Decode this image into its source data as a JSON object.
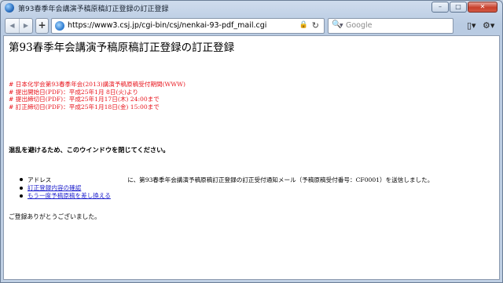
{
  "window": {
    "title": "第93春季年会講演予稿原稿訂正登録の訂正登録",
    "minimize": "–",
    "maximize": "□",
    "close": "✕"
  },
  "toolbar": {
    "back": "◀",
    "forward": "▶",
    "add_tab": "+",
    "url": "https://www3.csj.jp/cgi-bin/csj/nenkai-93-pdf_mail.cgi",
    "lock": "🔒",
    "reload": "↻",
    "search_icon": "🔍",
    "search_dropdown": "▼",
    "search_placeholder": "Google",
    "page_menu": "▯▾",
    "tools_menu": "⚙▾"
  },
  "page": {
    "heading": "第93春季年会講演予稿原稿訂正登録の訂正登録",
    "red_lines": [
      "# 日本化学会第93春季年会(2013)講演予稿原稿受付期間(WWW)",
      "# 提出開始日(PDF)：平成25年1月 8日(火)より",
      "# 提出締切日(PDF)：平成25年1月17日(木) 24:00まで",
      "# 訂正締切日(PDF)：平成25年1月18日(金) 15:00まで"
    ],
    "close_notice": "混乱を避けるため、このウインドウを閉じてください。",
    "address_label": "アドレス",
    "address_message": "に、第93春季年会講演予稿原稿訂正登録の訂正受付通知メール（予稿原稿受付番号：CF0001）を送信しました。",
    "link_confirm": "訂正登録内容の確認",
    "link_replace": "もう一度予稿原稿を差し換える",
    "thanks": "ご登録ありがとうございました。"
  },
  "colors": {
    "red_text": "#e8131b",
    "link": "#1d1fcc"
  }
}
